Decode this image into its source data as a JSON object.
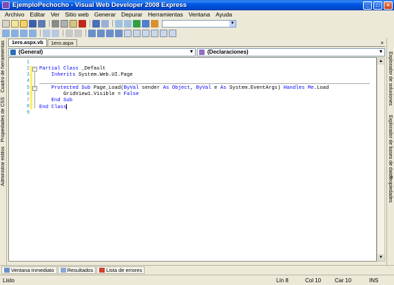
{
  "window": {
    "title": "EjemploPechocho - Visual Web Developer 2008 Express"
  },
  "menu": [
    "Archivo",
    "Editar",
    "Ver",
    "Sitio web",
    "Generar",
    "Depurar",
    "Herramientas",
    "Ventana",
    "Ayuda"
  ],
  "side_left": {
    "items": [
      "Cuadro de herramientas",
      "Propiedades de CSS",
      "Administrar estilos"
    ]
  },
  "side_right": {
    "items": [
      "Explorador de soluciones",
      "Explorador de bases de datos",
      "Propiedades"
    ]
  },
  "doc_tabs": [
    "1ero.aspx.vb",
    "1ero.aspx"
  ],
  "combos": {
    "left": "(General)",
    "right": "(Declaraciones)"
  },
  "code": {
    "line_numbers": [
      "1",
      "2",
      "3",
      "4",
      "5",
      "6",
      "7",
      "8",
      "9"
    ],
    "lines": [
      "",
      "Partial Class _Default",
      "    Inherits System.Web.UI.Page",
      "",
      "    Protected Sub Page_Load(ByVal sender As Object, ByVal e As System.EventArgs) Handles Me.Load",
      "        GridView1.Visible = False",
      "    End Sub",
      "End Class",
      ""
    ]
  },
  "bottom_tabs": [
    "Ventana Inmediato",
    "Resultados",
    "Lista de errores"
  ],
  "status": {
    "ready": "Listo",
    "line": "Lín 8",
    "col": "Col 10",
    "char": "Car 10",
    "mode": "INS"
  }
}
